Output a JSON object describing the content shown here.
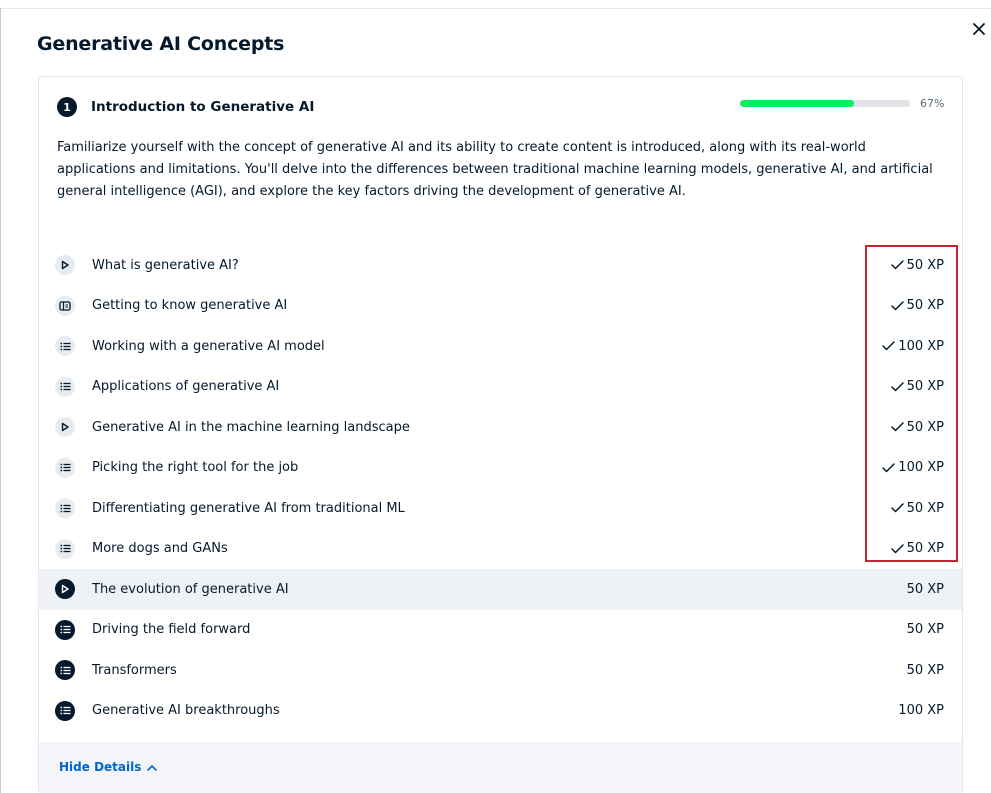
{
  "modal": {
    "title": "Generative AI Concepts",
    "close_glyph": "×"
  },
  "chapter": {
    "number": "1",
    "title": "Introduction to Generative AI",
    "progress_percent": 67,
    "progress_label": "67%",
    "description": "Familiarize yourself with the concept of generative AI and its ability to create content is introduced, along with its real-world applications and limitations. You'll delve into the differences between traditional machine learning models, generative AI, and artificial general intelligence (AGI), and explore the key factors driving the development of generative AI.",
    "lessons": [
      {
        "title": "What is generative AI?",
        "xp": "50 XP",
        "icon": "video-icon",
        "completed": true
      },
      {
        "title": "Getting to know generative AI",
        "xp": "50 XP",
        "icon": "slides-icon",
        "completed": true
      },
      {
        "title": "Working with a generative AI model",
        "xp": "100 XP",
        "icon": "exercise-icon",
        "completed": true
      },
      {
        "title": "Applications of generative AI",
        "xp": "50 XP",
        "icon": "exercise-icon",
        "completed": true
      },
      {
        "title": "Generative AI in the machine learning landscape",
        "xp": "50 XP",
        "icon": "video-icon",
        "completed": true
      },
      {
        "title": "Picking the right tool for the job",
        "xp": "100 XP",
        "icon": "exercise-icon",
        "completed": true
      },
      {
        "title": "Differentiating generative AI from traditional ML",
        "xp": "50 XP",
        "icon": "exercise-icon",
        "completed": true
      },
      {
        "title": "More dogs and GANs",
        "xp": "50 XP",
        "icon": "exercise-icon",
        "completed": true
      },
      {
        "title": "The evolution of generative AI",
        "xp": "50 XP",
        "icon": "video-icon",
        "completed": false
      },
      {
        "title": "Driving the field forward",
        "xp": "50 XP",
        "icon": "exercise-icon",
        "completed": false
      },
      {
        "title": "Transformers",
        "xp": "50 XP",
        "icon": "exercise-icon",
        "completed": false
      },
      {
        "title": "Generative AI breakthroughs",
        "xp": "100 XP",
        "icon": "exercise-icon",
        "completed": false
      }
    ],
    "hide_details_label": "Hide Details"
  },
  "colors": {
    "navy": "#05192d",
    "progress_green": "#03ef62",
    "link_blue": "#0065d1",
    "annotation_red": "#c0272d",
    "row_highlight": "#eef1f5"
  }
}
